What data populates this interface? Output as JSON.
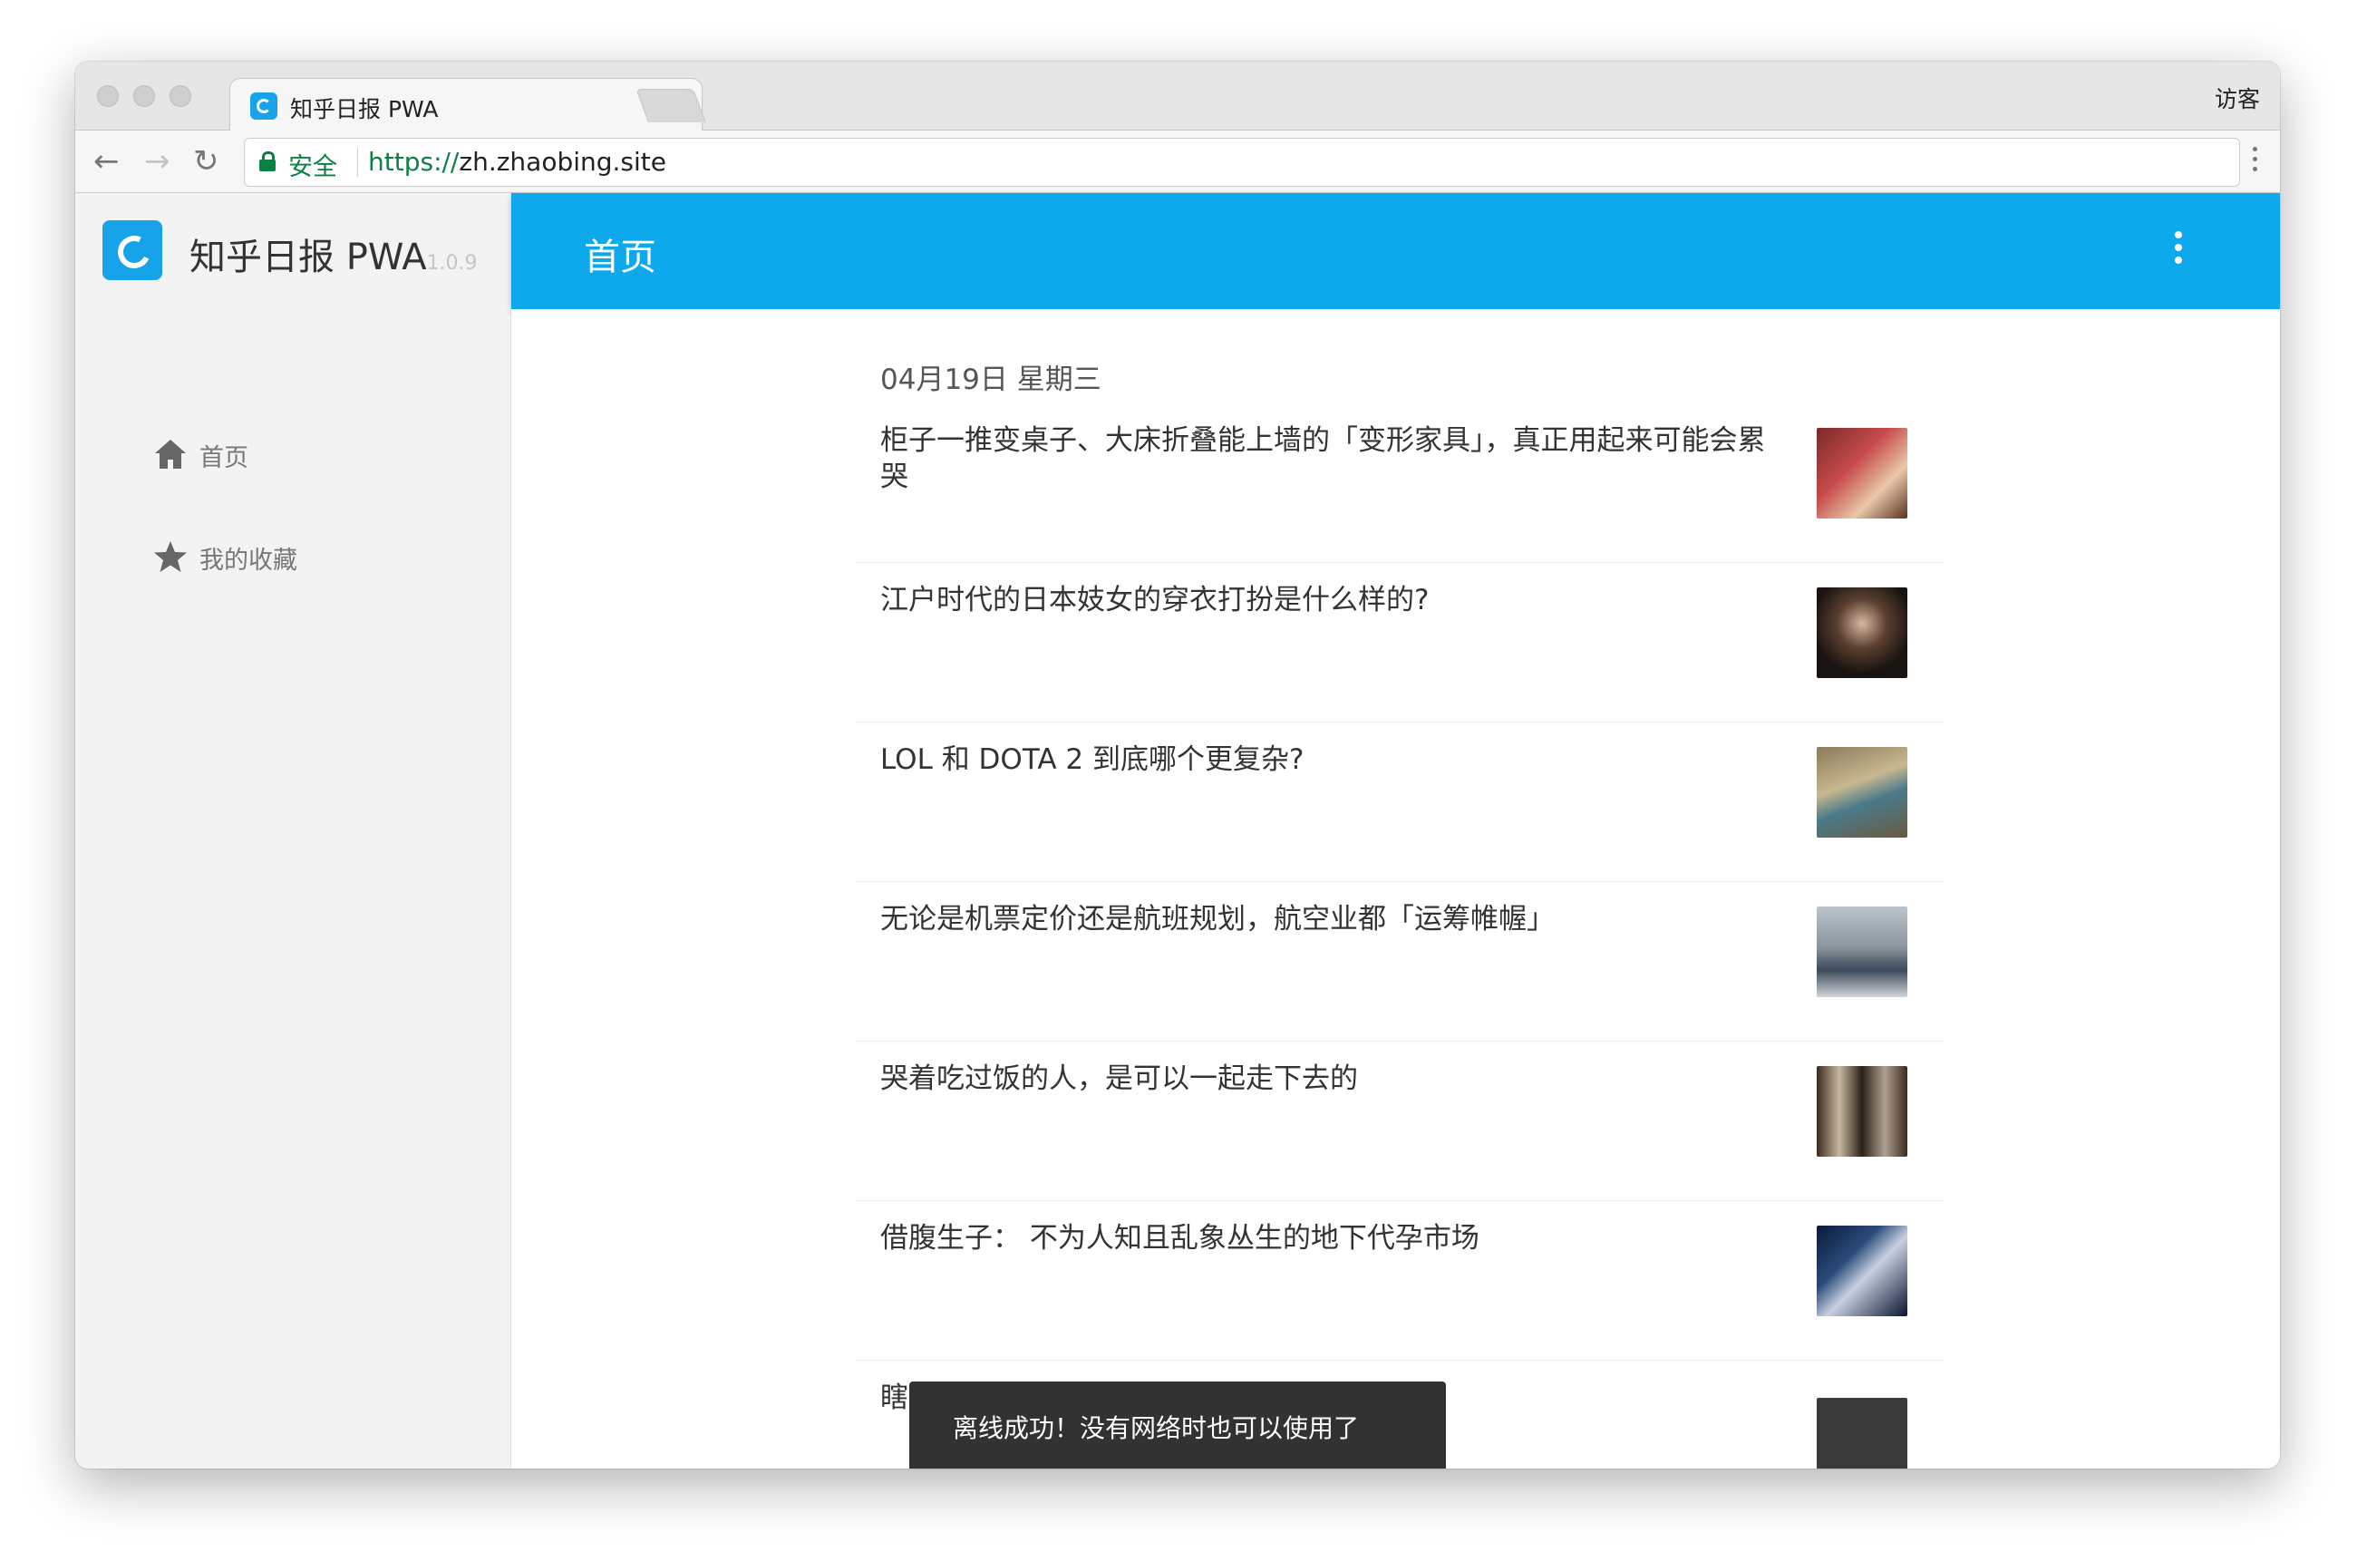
{
  "browser": {
    "tab_title": "知乎日报 PWA",
    "tab_close": "×",
    "profile_label": "访客",
    "back_glyph": "←",
    "forward_glyph": "→",
    "reload_glyph": "↻",
    "secure_label": "安全",
    "url_scheme": "https://",
    "url_host": "zh.zhaobing.site"
  },
  "sidebar": {
    "brand": "知乎日报 PWA",
    "version": "1.0.9",
    "items": [
      {
        "label": "首页",
        "icon": "home-icon"
      },
      {
        "label": "我的收藏",
        "icon": "star-icon"
      }
    ]
  },
  "appbar": {
    "title": "首页",
    "menu_icon": "more-vertical-icon"
  },
  "feed": {
    "date": "04月19日 星期三",
    "stories": [
      {
        "title": "柜子一推变桌子、大床折叠能上墙的「变形家具」，真正用起来可能会累哭"
      },
      {
        "title": "江户时代的日本妓女的穿衣打扮是什么样的?"
      },
      {
        "title": "LOL 和 DOTA 2 到底哪个更复杂?"
      },
      {
        "title": "无论是机票定价还是航班规划，航空业都「运筹帷幄」"
      },
      {
        "title": "哭着吃过饭的人，是可以一起走下去的"
      },
      {
        "title": "借腹生子： 不为人知且乱象丛生的地下代孕市场"
      },
      {
        "title": "瞎"
      }
    ]
  },
  "snackbar": {
    "message": "离线成功！没有网络时也可以使用了"
  },
  "colors": {
    "accent": "#0ea8ec",
    "secure_green": "#0b8043",
    "snackbar_bg": "#323232"
  }
}
